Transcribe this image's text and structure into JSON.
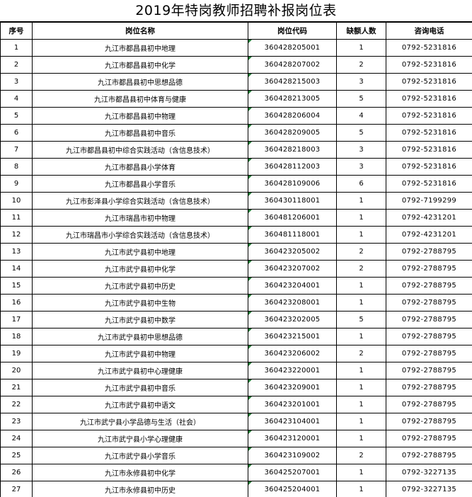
{
  "document": {
    "title": "2019年特岗教师招聘补报岗位表",
    "columns": [
      "序号",
      "岗位名称",
      "岗位代码",
      "缺额人数",
      "咨询电话"
    ],
    "rows": [
      {
        "no": "1",
        "name": "九江市都昌县初中地理",
        "code": "360428205001",
        "count": "1",
        "phone": "0792-5231816"
      },
      {
        "no": "2",
        "name": "九江市都昌县初中化学",
        "code": "360428207002",
        "count": "2",
        "phone": "0792-5231816"
      },
      {
        "no": "3",
        "name": "九江市都昌县初中思想品德",
        "code": "360428215003",
        "count": "3",
        "phone": "0792-5231816"
      },
      {
        "no": "4",
        "name": "九江市都昌县初中体育与健康",
        "code": "360428213005",
        "count": "5",
        "phone": "0792-5231816"
      },
      {
        "no": "5",
        "name": "九江市都昌县初中物理",
        "code": "360428206004",
        "count": "4",
        "phone": "0792-5231816"
      },
      {
        "no": "6",
        "name": "九江市都昌县初中音乐",
        "code": "360428209005",
        "count": "5",
        "phone": "0792-5231816"
      },
      {
        "no": "7",
        "name": "九江市都昌县初中综合实践活动（含信息技术）",
        "code": "360428218003",
        "count": "3",
        "phone": "0792-5231816"
      },
      {
        "no": "8",
        "name": "九江市都昌县小学体育",
        "code": "360428112003",
        "count": "3",
        "phone": "0792-5231816"
      },
      {
        "no": "9",
        "name": "九江市都昌县小学音乐",
        "code": "360428109006",
        "count": "6",
        "phone": "0792-5231816"
      },
      {
        "no": "10",
        "name": "九江市彭泽县小学综合实践活动（含信息技术）",
        "code": "360430118001",
        "count": "1",
        "phone": "0792-7199299"
      },
      {
        "no": "11",
        "name": "九江市瑞昌市初中物理",
        "code": "360481206001",
        "count": "1",
        "phone": "0792-4231201"
      },
      {
        "no": "12",
        "name": "九江市瑞昌市小学综合实践活动（含信息技术）",
        "code": "360481118001",
        "count": "1",
        "phone": "0792-4231201"
      },
      {
        "no": "13",
        "name": "九江市武宁县初中地理",
        "code": "360423205002",
        "count": "2",
        "phone": "0792-2788795"
      },
      {
        "no": "14",
        "name": "九江市武宁县初中化学",
        "code": "360423207002",
        "count": "2",
        "phone": "0792-2788795"
      },
      {
        "no": "15",
        "name": "九江市武宁县初中历史",
        "code": "360423204001",
        "count": "1",
        "phone": "0792-2788795"
      },
      {
        "no": "16",
        "name": "九江市武宁县初中生物",
        "code": "360423208001",
        "count": "1",
        "phone": "0792-2788795"
      },
      {
        "no": "17",
        "name": "九江市武宁县初中数学",
        "code": "360423202005",
        "count": "5",
        "phone": "0792-2788795"
      },
      {
        "no": "18",
        "name": "九江市武宁县初中思想品德",
        "code": "360423215001",
        "count": "1",
        "phone": "0792-2788795"
      },
      {
        "no": "19",
        "name": "九江市武宁县初中物理",
        "code": "360423206002",
        "count": "2",
        "phone": "0792-2788795"
      },
      {
        "no": "20",
        "name": "九江市武宁县初中心理健康",
        "code": "360423220001",
        "count": "1",
        "phone": "0792-2788795"
      },
      {
        "no": "21",
        "name": "九江市武宁县初中音乐",
        "code": "360423209001",
        "count": "1",
        "phone": "0792-2788795"
      },
      {
        "no": "22",
        "name": "九江市武宁县初中语文",
        "code": "360423201001",
        "count": "1",
        "phone": "0792-2788795"
      },
      {
        "no": "23",
        "name": "九江市武宁县小学品德与生活（社会）",
        "code": "360423104001",
        "count": "1",
        "phone": "0792-2788795"
      },
      {
        "no": "24",
        "name": "九江市武宁县小学心理健康",
        "code": "360423120001",
        "count": "1",
        "phone": "0792-2788795"
      },
      {
        "no": "25",
        "name": "九江市武宁县小学音乐",
        "code": "360423109002",
        "count": "2",
        "phone": "0792-2788795"
      },
      {
        "no": "26",
        "name": "九江市永修县初中化学",
        "code": "360425207001",
        "count": "1",
        "phone": "0792-3227135"
      },
      {
        "no": "27",
        "name": "九江市永修县初中历史",
        "code": "360425204001",
        "count": "1",
        "phone": "0792-3227135"
      }
    ]
  },
  "colors": {
    "border": "#000000",
    "note_marker": "#1e7b34",
    "background": "#ffffff"
  }
}
